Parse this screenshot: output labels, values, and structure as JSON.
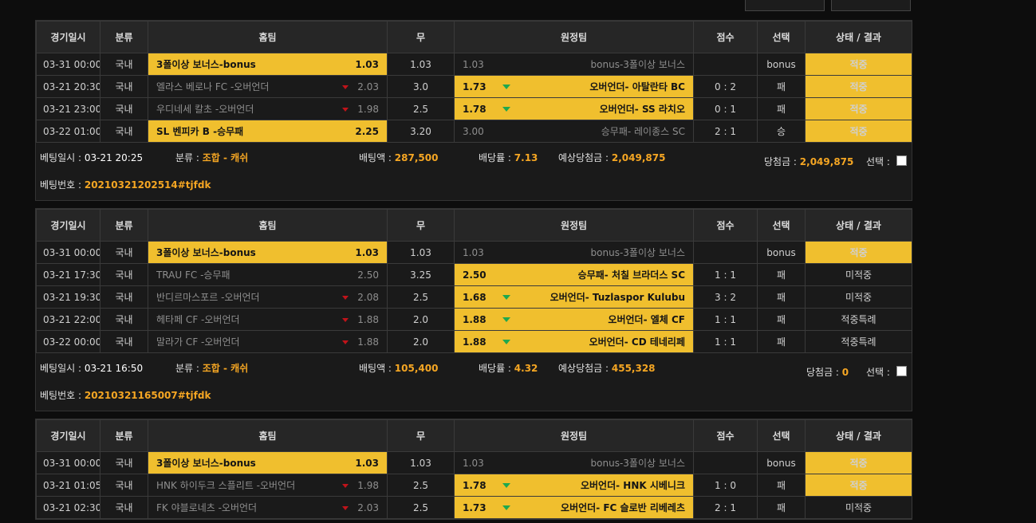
{
  "headers": [
    "경기일시",
    "분류",
    "홈팀",
    "무",
    "원정팀",
    "점수",
    "선택",
    "상태 / 결과"
  ],
  "labels": {
    "bet_time": "베팅일시 : ",
    "category": "분류 : ",
    "bet_amount": "배팅액 : ",
    "odds": "배당률 : ",
    "expected": "예상당첨금 : ",
    "win": "당첨금 : ",
    "select": "선택 : ",
    "bet_no": "베팅번호 : "
  },
  "slips": [
    {
      "rows": [
        {
          "date": "03-31 00:00",
          "cat": "국내",
          "home": "3폴이상 보너스-bonus",
          "home_odds": "1.03",
          "home_sel": true,
          "home_arrow": false,
          "draw": "1.03",
          "away": "bonus-3폴이상 보너스",
          "away_odds": "1.03",
          "away_sel": false,
          "away_arrow": false,
          "score": "",
          "pick": "bonus",
          "result": "적중",
          "hit": true
        },
        {
          "date": "03-21 20:30",
          "cat": "국내",
          "home": "엘라스 베로나 FC -오버언더",
          "home_odds": "2.03",
          "home_sel": false,
          "home_arrow": true,
          "draw": "3.0",
          "away": "오버언더- 아탈란타 BC",
          "away_odds": "1.73",
          "away_sel": true,
          "away_arrow": true,
          "score": "0 : 2",
          "pick": "패",
          "result": "적중",
          "hit": true
        },
        {
          "date": "03-21 23:00",
          "cat": "국내",
          "home": "우디네세 칼초 -오버언더",
          "home_odds": "1.98",
          "home_sel": false,
          "home_arrow": true,
          "draw": "2.5",
          "away": "오버언더- SS 라치오",
          "away_odds": "1.78",
          "away_sel": true,
          "away_arrow": true,
          "score": "0 : 1",
          "pick": "패",
          "result": "적중",
          "hit": true
        },
        {
          "date": "03-22 01:00",
          "cat": "국내",
          "home": "SL 벤피카 B -승무패",
          "home_odds": "2.25",
          "home_sel": true,
          "home_arrow": false,
          "draw": "3.20",
          "away": "승무패- 레이종스 SC",
          "away_odds": "3.00",
          "away_sel": false,
          "away_arrow": false,
          "score": "2 : 1",
          "pick": "승",
          "result": "적중",
          "hit": true
        }
      ],
      "summary": {
        "bet_time": "03-21 20:25",
        "category": "조합 - 캐쉬",
        "bet_amount": "287,500",
        "odds": "7.13",
        "expected": "2,049,875",
        "win": "2,049,875",
        "bet_no": "20210321202514#tjfdk"
      }
    },
    {
      "rows": [
        {
          "date": "03-31 00:00",
          "cat": "국내",
          "home": "3폴이상 보너스-bonus",
          "home_odds": "1.03",
          "home_sel": true,
          "home_arrow": false,
          "draw": "1.03",
          "away": "bonus-3폴이상 보너스",
          "away_odds": "1.03",
          "away_sel": false,
          "away_arrow": false,
          "score": "",
          "pick": "bonus",
          "result": "적중",
          "hit": true
        },
        {
          "date": "03-21 17:30",
          "cat": "국내",
          "home": "TRAU FC -승무패",
          "home_odds": "2.50",
          "home_sel": false,
          "home_arrow": false,
          "draw": "3.25",
          "away": "승무패- 처칠 브라더스 SC",
          "away_odds": "2.50",
          "away_sel": true,
          "away_arrow": false,
          "score": "1 : 1",
          "pick": "패",
          "result": "미적중",
          "hit": false
        },
        {
          "date": "03-21 19:30",
          "cat": "국내",
          "home": "반디르마스포르 -오버언더",
          "home_odds": "2.08",
          "home_sel": false,
          "home_arrow": true,
          "draw": "2.5",
          "away": "오버언더- Tuzlaspor Kulubu",
          "away_odds": "1.68",
          "away_sel": true,
          "away_arrow": true,
          "score": "3 : 2",
          "pick": "패",
          "result": "미적중",
          "hit": false
        },
        {
          "date": "03-21 22:00",
          "cat": "국내",
          "home": "헤타페 CF -오버언더",
          "home_odds": "1.88",
          "home_sel": false,
          "home_arrow": true,
          "draw": "2.0",
          "away": "오버언더- 엘체 CF",
          "away_odds": "1.88",
          "away_sel": true,
          "away_arrow": true,
          "score": "1 : 1",
          "pick": "패",
          "result": "적중특례",
          "hit": false
        },
        {
          "date": "03-22 00:00",
          "cat": "국내",
          "home": "말라가 CF -오버언더",
          "home_odds": "1.88",
          "home_sel": false,
          "home_arrow": true,
          "draw": "2.0",
          "away": "오버언더- CD 테네리페",
          "away_odds": "1.88",
          "away_sel": true,
          "away_arrow": true,
          "score": "1 : 1",
          "pick": "패",
          "result": "적중특례",
          "hit": false
        }
      ],
      "summary": {
        "bet_time": "03-21 16:50",
        "category": "조합 - 캐쉬",
        "bet_amount": "105,400",
        "odds": "4.32",
        "expected": "455,328",
        "win": "0",
        "bet_no": "20210321165007#tjfdk"
      }
    },
    {
      "rows": [
        {
          "date": "03-31 00:00",
          "cat": "국내",
          "home": "3폴이상 보너스-bonus",
          "home_odds": "1.03",
          "home_sel": true,
          "home_arrow": false,
          "draw": "1.03",
          "away": "bonus-3폴이상 보너스",
          "away_odds": "1.03",
          "away_sel": false,
          "away_arrow": false,
          "score": "",
          "pick": "bonus",
          "result": "적중",
          "hit": true
        },
        {
          "date": "03-21 01:05",
          "cat": "국내",
          "home": "HNK 하이두크 스플리트 -오버언더",
          "home_odds": "1.98",
          "home_sel": false,
          "home_arrow": true,
          "draw": "2.5",
          "away": "오버언더- HNK 시베니크",
          "away_odds": "1.78",
          "away_sel": true,
          "away_arrow": true,
          "score": "1 : 0",
          "pick": "패",
          "result": "적중",
          "hit": true
        },
        {
          "date": "03-21 02:30",
          "cat": "국내",
          "home": "FK 야블로네츠 -오버언더",
          "home_odds": "2.03",
          "home_sel": false,
          "home_arrow": true,
          "draw": "2.5",
          "away": "오버언더- FC 슬로반 리베레츠",
          "away_odds": "1.73",
          "away_sel": true,
          "away_arrow": true,
          "score": "2 : 1",
          "pick": "패",
          "result": "미적중",
          "hit": false
        }
      ],
      "summary": null
    }
  ]
}
